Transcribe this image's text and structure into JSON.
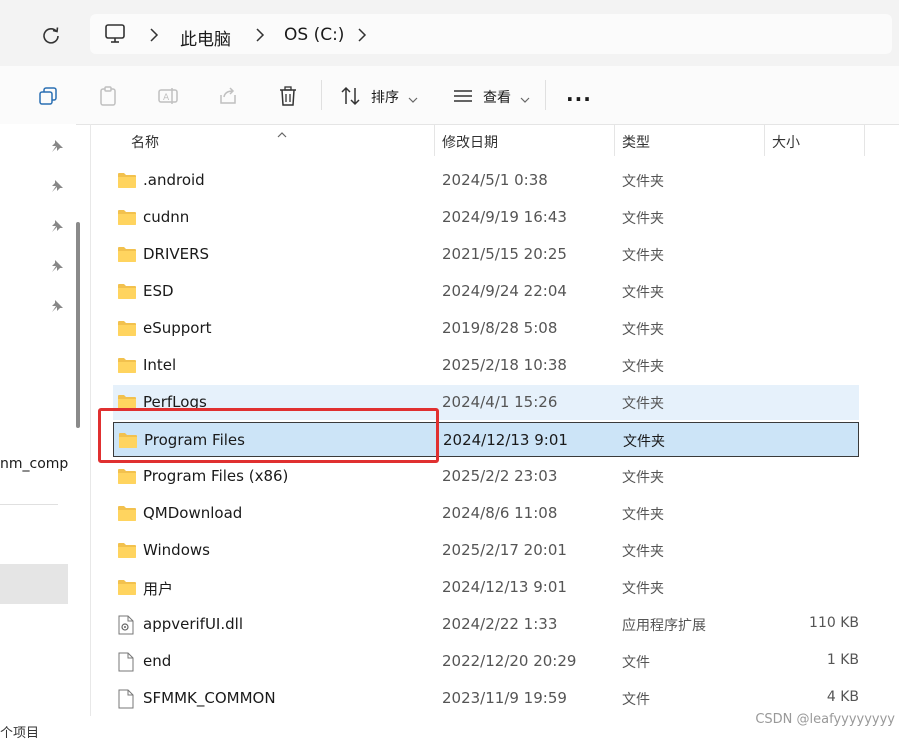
{
  "address": {
    "crumbs": [
      "此电脑",
      "OS (C:)"
    ]
  },
  "toolbar": {
    "sort_label": "排序",
    "view_label": "查看",
    "more_label": "..."
  },
  "columns": {
    "name": "名称",
    "modified": "修改日期",
    "type": "类型",
    "size": "大小"
  },
  "files": [
    {
      "name": ".android",
      "modified": "2024/5/1 0:38",
      "type": "文件夹",
      "size": "",
      "icon": "folder-icon"
    },
    {
      "name": "cudnn",
      "modified": "2024/9/19 16:43",
      "type": "文件夹",
      "size": "",
      "icon": "folder-icon"
    },
    {
      "name": "DRIVERS",
      "modified": "2021/5/15 20:25",
      "type": "文件夹",
      "size": "",
      "icon": "folder-icon"
    },
    {
      "name": "ESD",
      "modified": "2024/9/24 22:04",
      "type": "文件夹",
      "size": "",
      "icon": "folder-icon"
    },
    {
      "name": "eSupport",
      "modified": "2019/8/28 5:08",
      "type": "文件夹",
      "size": "",
      "icon": "folder-icon"
    },
    {
      "name": "Intel",
      "modified": "2025/2/18 10:38",
      "type": "文件夹",
      "size": "",
      "icon": "folder-icon"
    },
    {
      "name": "PerfLogs",
      "modified": "2024/4/1 15:26",
      "type": "文件夹",
      "size": "",
      "icon": "folder-icon"
    },
    {
      "name": "Program Files",
      "modified": "2024/12/13 9:01",
      "type": "文件夹",
      "size": "",
      "icon": "folder-icon"
    },
    {
      "name": "Program Files (x86)",
      "modified": "2025/2/2 23:03",
      "type": "文件夹",
      "size": "",
      "icon": "folder-icon"
    },
    {
      "name": "QMDownload",
      "modified": "2024/8/6 11:08",
      "type": "文件夹",
      "size": "",
      "icon": "folder-icon"
    },
    {
      "name": "Windows",
      "modified": "2025/2/17 20:01",
      "type": "文件夹",
      "size": "",
      "icon": "folder-icon"
    },
    {
      "name": "用户",
      "modified": "2024/12/13 9:01",
      "type": "文件夹",
      "size": "",
      "icon": "folder-icon"
    },
    {
      "name": "appverifUI.dll",
      "modified": "2024/2/22 1:33",
      "type": "应用程序扩展",
      "size": "110 KB",
      "icon": "dll-file-icon"
    },
    {
      "name": "end",
      "modified": "2022/12/20 20:29",
      "type": "文件",
      "size": "1 KB",
      "icon": "file-icon"
    },
    {
      "name": "SFMMK_COMMON",
      "modified": "2023/11/9 19:59",
      "type": "文件",
      "size": "4 KB",
      "icon": "file-icon"
    }
  ],
  "nav": {
    "partial_item_label": "nm_comp"
  },
  "status": {
    "text": "个项目"
  },
  "watermark": "CSDN @leafyyyyyyyy"
}
